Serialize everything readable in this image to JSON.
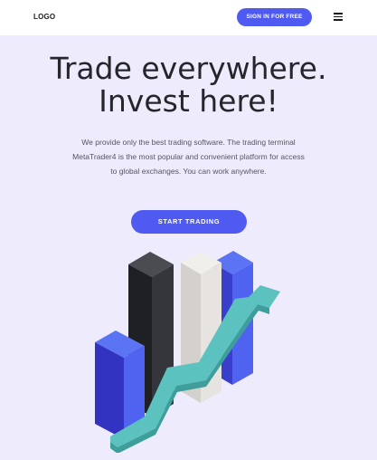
{
  "header": {
    "logo": "LOGO",
    "signin_label": "SIGN IN FOR FREE",
    "menu_icon": "hamburger-icon"
  },
  "hero": {
    "title_line1": "Trade everywhere.",
    "title_line2": "Invest here!",
    "description": "We provide only the best trading software. The trading terminal MetaTrader4 is the most popular and convenient platform for access to global exchanges. You can work anywhere.",
    "cta_label": "START TRADING"
  },
  "illustration": {
    "name": "bar-chart-with-rising-arrow",
    "colors": {
      "blue": "#4F63F0",
      "dark": "#2E3036",
      "light": "#E2DEDB",
      "arrow": "#5BC2BF"
    }
  },
  "colors": {
    "accent": "#4F5BF0",
    "background": "#EEEBFC",
    "header_bg": "#FFFFFF",
    "title": "#24262B"
  }
}
